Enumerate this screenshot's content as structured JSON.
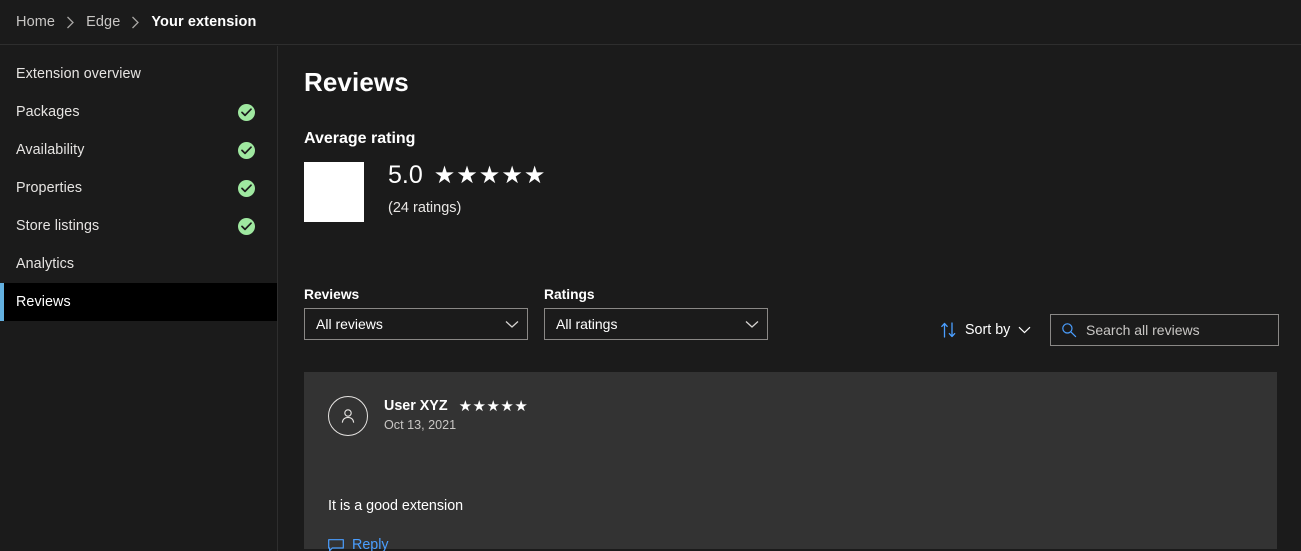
{
  "breadcrumb": {
    "items": [
      {
        "label": "Home",
        "current": false
      },
      {
        "label": "Edge",
        "current": false
      },
      {
        "label": "Your extension",
        "current": true
      }
    ],
    "separator_icon": "chevron-right-icon"
  },
  "sidebar": {
    "items": [
      {
        "label": "Extension overview",
        "complete": false,
        "selected": false
      },
      {
        "label": "Packages",
        "complete": true,
        "selected": false
      },
      {
        "label": "Availability",
        "complete": true,
        "selected": false
      },
      {
        "label": "Properties",
        "complete": true,
        "selected": false
      },
      {
        "label": "Store listings",
        "complete": true,
        "selected": false
      },
      {
        "label": "Analytics",
        "complete": false,
        "selected": false
      },
      {
        "label": "Reviews",
        "complete": false,
        "selected": true
      }
    ],
    "complete_icon": "check-circle-icon"
  },
  "main": {
    "page_title": "Reviews",
    "average_rating": {
      "section_title": "Average rating",
      "score": "5.0",
      "stars": "★★★★★",
      "stars_count": 5,
      "count_label": "(24 ratings)"
    },
    "filters": {
      "reviews": {
        "label": "Reviews",
        "value": "All reviews",
        "options": [
          "All reviews"
        ],
        "chevron_icon": "chevron-down-icon"
      },
      "ratings": {
        "label": "Ratings",
        "value": "All ratings",
        "options": [
          "All ratings"
        ],
        "chevron_icon": "chevron-down-icon"
      },
      "sort": {
        "label": "Sort by",
        "icon": "sort-arrows-icon",
        "chevron_icon": "chevron-down-icon"
      },
      "search": {
        "placeholder": "Search all reviews",
        "value": "",
        "icon": "search-icon"
      }
    },
    "reviews": [
      {
        "avatar_icon": "person-icon",
        "author": "User XYZ",
        "stars": "★★★★★",
        "stars_count": 5,
        "date": "Oct 13, 2021",
        "text": "It is a good extension",
        "reply_label": "Reply",
        "reply_icon": "comment-icon"
      }
    ]
  },
  "colors": {
    "page_bg": "#1b1b1b",
    "card_bg": "#333333",
    "selected_nav_bg": "#000000",
    "accent_bar": "#63b0e0",
    "link_blue": "#4a9eff",
    "success_green": "#9fe8a0",
    "border": "#8a8886"
  }
}
